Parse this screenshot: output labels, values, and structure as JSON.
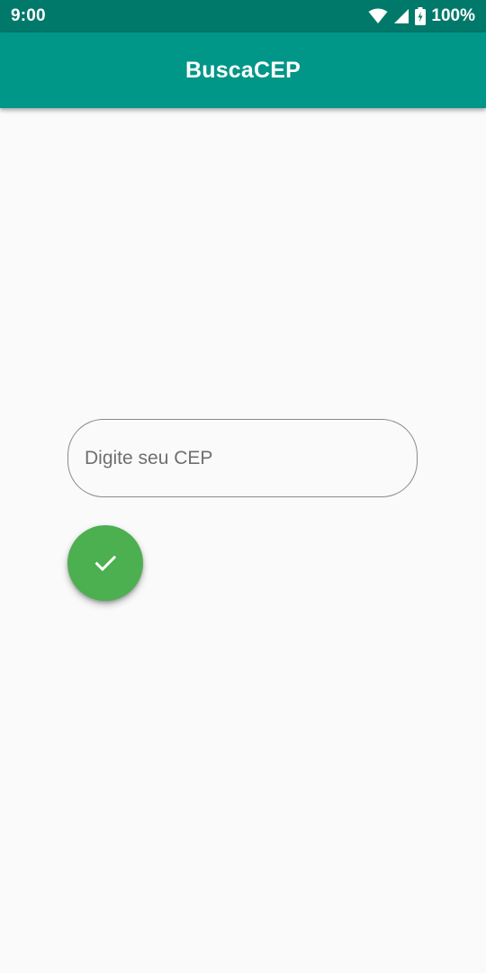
{
  "status_bar": {
    "time": "9:00",
    "battery_percent": "100%",
    "icons": [
      "wifi-icon",
      "signal-icon",
      "battery-charging-icon"
    ]
  },
  "app_bar": {
    "title": "BuscaCEP"
  },
  "form": {
    "cep_placeholder": "Digite seu CEP",
    "cep_value": "",
    "submit_icon": "check-icon"
  },
  "colors": {
    "status_bar": "#00796b",
    "app_bar": "#009688",
    "fab": "#4caf50",
    "background": "#fafafa"
  }
}
